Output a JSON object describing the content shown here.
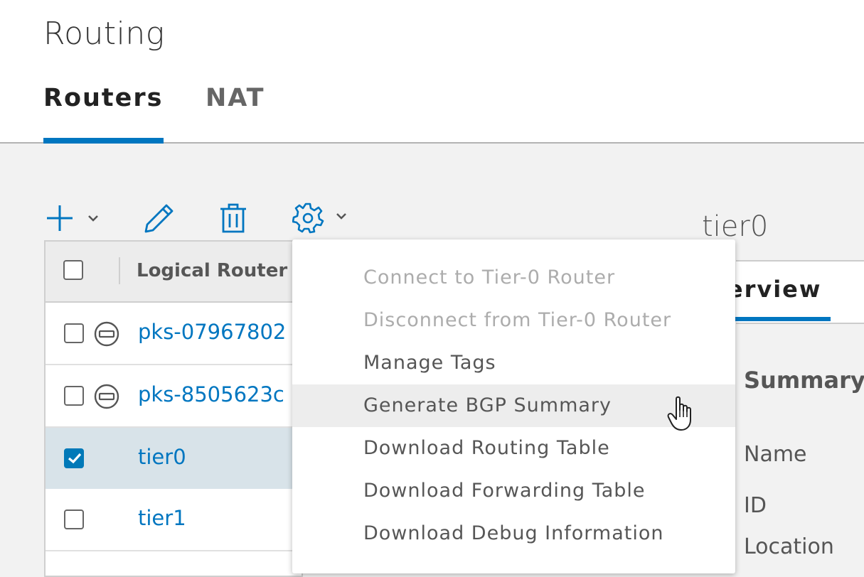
{
  "page": {
    "title": "Routing"
  },
  "tabs": [
    {
      "label": "Routers",
      "active": true
    },
    {
      "label": "NAT",
      "active": false
    }
  ],
  "toolbar": {
    "add_icon": "plus-icon",
    "edit_icon": "pencil-icon",
    "delete_icon": "trash-icon",
    "actions_icon": "gear-icon"
  },
  "grid": {
    "column_header": "Logical Router",
    "rows": [
      {
        "name": "pks-07967802",
        "status_icon": "minus-circle-icon",
        "selected": false
      },
      {
        "name": "pks-8505623c",
        "status_icon": "minus-circle-icon",
        "selected": false
      },
      {
        "name": "tier0",
        "status_icon": "",
        "selected": true
      },
      {
        "name": "tier1",
        "status_icon": "",
        "selected": false
      }
    ]
  },
  "actions_menu": {
    "items": [
      {
        "label": "Connect to Tier-0 Router",
        "disabled": true
      },
      {
        "label": "Disconnect from Tier-0 Router",
        "disabled": true
      },
      {
        "label": "Manage Tags",
        "disabled": false
      },
      {
        "label": "Generate BGP Summary",
        "disabled": false,
        "hovered": true
      },
      {
        "label": "Download Routing Table",
        "disabled": false
      },
      {
        "label": "Download Forwarding Table",
        "disabled": false
      },
      {
        "label": "Download Debug Information",
        "disabled": false
      }
    ]
  },
  "detail": {
    "title": "tier0",
    "tab_label": "verview",
    "summary_heading": "Summary",
    "fields": {
      "name": "Name",
      "id": "ID",
      "location": "Location"
    }
  },
  "colors": {
    "accent": "#0076c0",
    "checkbox_checked": "#0079b8",
    "selected_row": "#d8e3e9"
  }
}
